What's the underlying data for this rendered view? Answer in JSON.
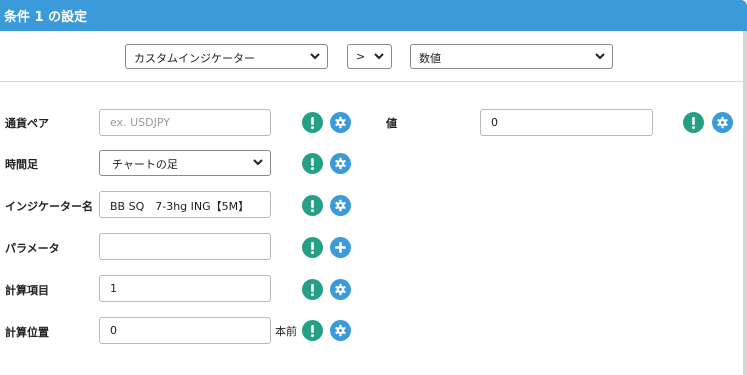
{
  "header": {
    "title": "条件 1 の設定"
  },
  "top_selects": {
    "indicator_type": "カスタムインジケーター",
    "operator": ">",
    "compare_type": "数値"
  },
  "rows": [
    {
      "label": "通貨ペア",
      "placeholder": "ex. USDJPY",
      "value": ""
    },
    {
      "label": "時間足",
      "value": "チャートの足"
    },
    {
      "label": "インジケーター名",
      "value": "BB SQ　7-3hg ING【5M】"
    },
    {
      "label": "パラメータ",
      "value": ""
    },
    {
      "label": "計算項目",
      "value": "1"
    },
    {
      "label": "計算位置",
      "value": "0",
      "suffix": "本前"
    }
  ],
  "value_field": {
    "label": "値",
    "value": "0"
  },
  "icons": {
    "info": "exclamation-icon",
    "settings": "gear-icon",
    "add": "plus-icon"
  },
  "colors": {
    "header": "#3b9ad9",
    "info_button": "#26a085",
    "settings_button": "#3b9ad9"
  }
}
